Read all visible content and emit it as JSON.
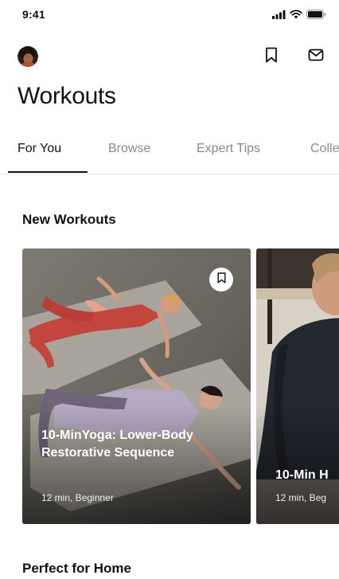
{
  "status_bar": {
    "time": "9:41"
  },
  "header": {
    "title": "Workouts"
  },
  "tabs": [
    {
      "label": "For You",
      "active": true
    },
    {
      "label": "Browse",
      "active": false
    },
    {
      "label": "Expert Tips",
      "active": false
    },
    {
      "label": "Colle",
      "active": false
    }
  ],
  "sections": {
    "new_workouts": {
      "title": "New Workouts",
      "cards": [
        {
          "title": "10-MinYoga: Lower-Body Restorative Sequence",
          "meta": "12 min, Beginner"
        },
        {
          "title": "10-Min H",
          "meta": "12 min, Beg"
        }
      ]
    },
    "perfect_for_home": {
      "title": "Perfect for Home"
    }
  },
  "colors": {
    "text": "#111111",
    "tab_inactive": "#8a8a8a",
    "divider": "#e6e6e6"
  },
  "icons": [
    "signal-icon",
    "wifi-icon",
    "battery-icon",
    "bookmark-icon",
    "inbox-icon"
  ]
}
